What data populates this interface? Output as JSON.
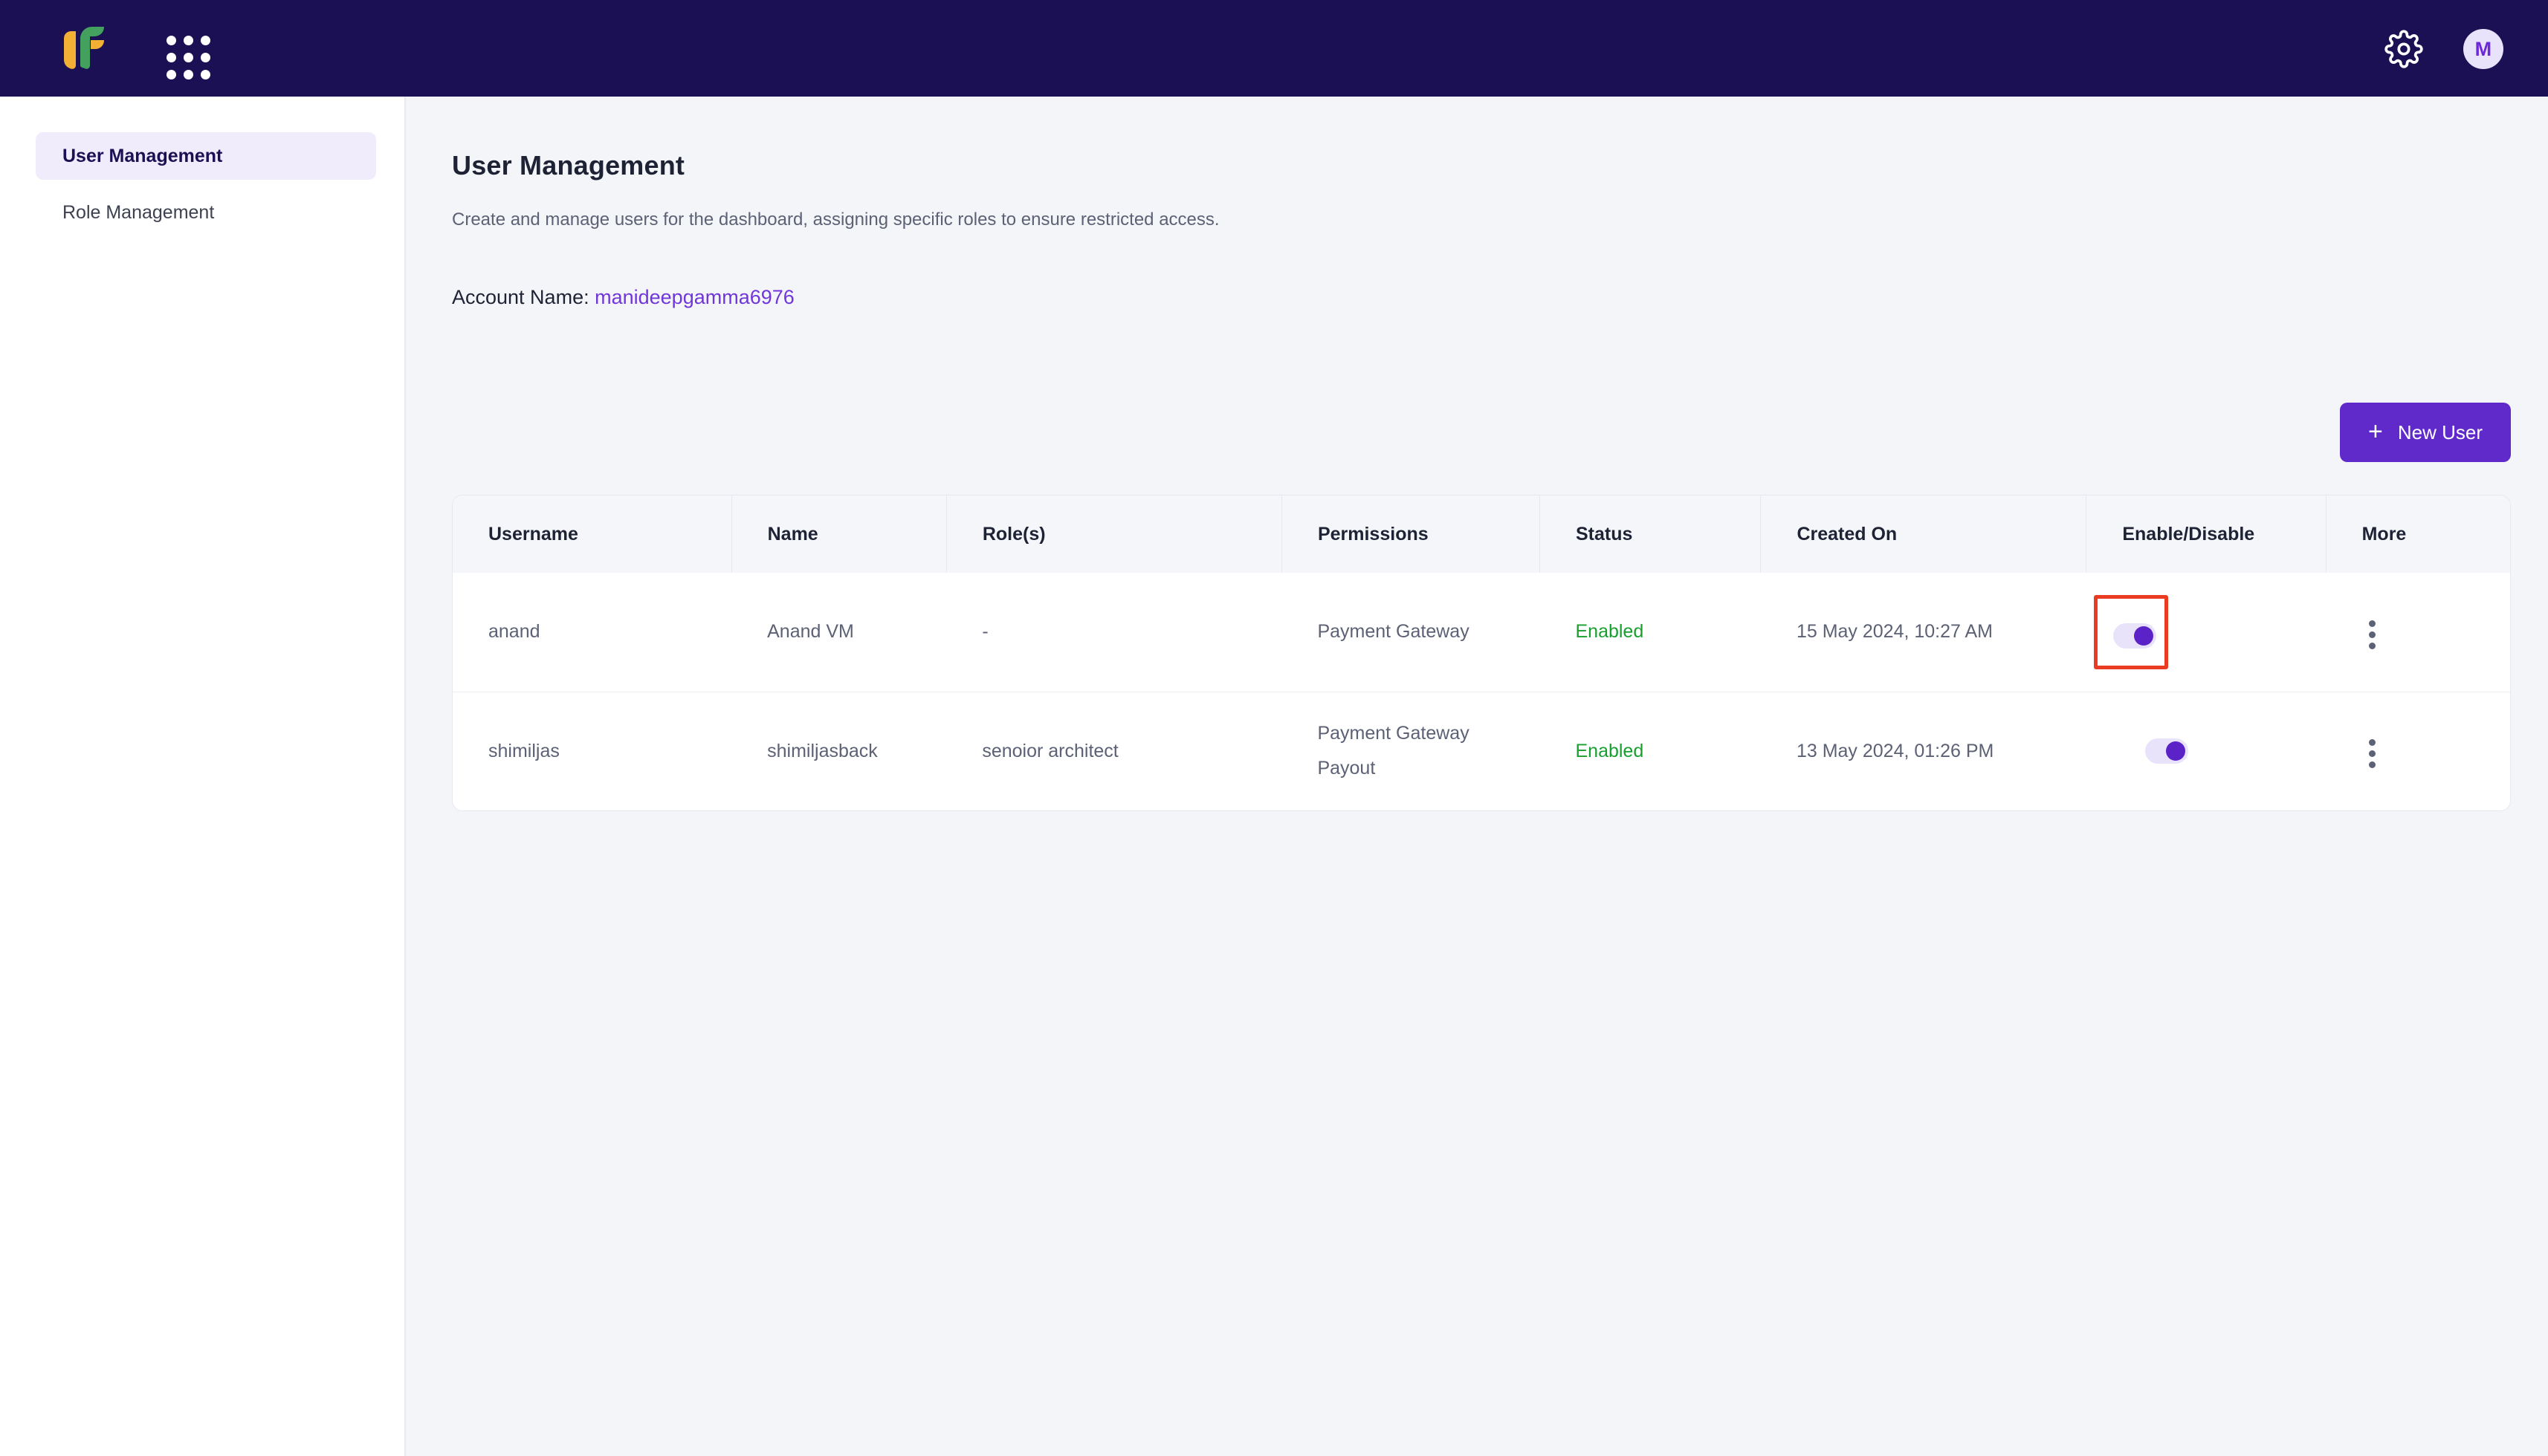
{
  "topbar": {
    "logo_name": "fileflow-logo",
    "apps_icon": "apps-grid-icon",
    "settings_icon": "gear-icon",
    "avatar_initial": "M"
  },
  "sidebar": {
    "items": [
      {
        "label": "User Management",
        "active": true
      },
      {
        "label": "Role Management",
        "active": false
      }
    ]
  },
  "main": {
    "title": "User Management",
    "subtitle": "Create and manage users for the dashboard, assigning specific roles to ensure restricted access.",
    "account_label": "Account Name:",
    "account_name": "manideepgamma6976",
    "new_user_button": "New User",
    "new_user_plus": "+"
  },
  "table": {
    "columns": [
      "Username",
      "Name",
      "Role(s)",
      "Permissions",
      "Status",
      "Created On",
      "Enable/Disable",
      "More"
    ],
    "rows": [
      {
        "username": "anand",
        "name": "Anand VM",
        "roles": "-",
        "permissions": [
          "Payment Gateway"
        ],
        "status": "Enabled",
        "created_on": "15 May 2024, 10:27 AM",
        "enabled": true,
        "highlighted": true
      },
      {
        "username": "shimiljas",
        "name": "shimiljasback",
        "roles": "senoior architect",
        "permissions": [
          "Payment Gateway",
          "Payout"
        ],
        "status": "Enabled",
        "created_on": "13 May 2024, 01:26 PM",
        "enabled": true,
        "highlighted": false
      }
    ]
  },
  "colors": {
    "header_bg": "#1b1053",
    "accent_purple": "#6029c9",
    "link_purple": "#7036d9",
    "status_green": "#17a02e",
    "highlight_red": "#ea3c23",
    "page_bg": "#f4f5f9",
    "logo_green": "#44a05f",
    "logo_orange": "#f2b135"
  }
}
